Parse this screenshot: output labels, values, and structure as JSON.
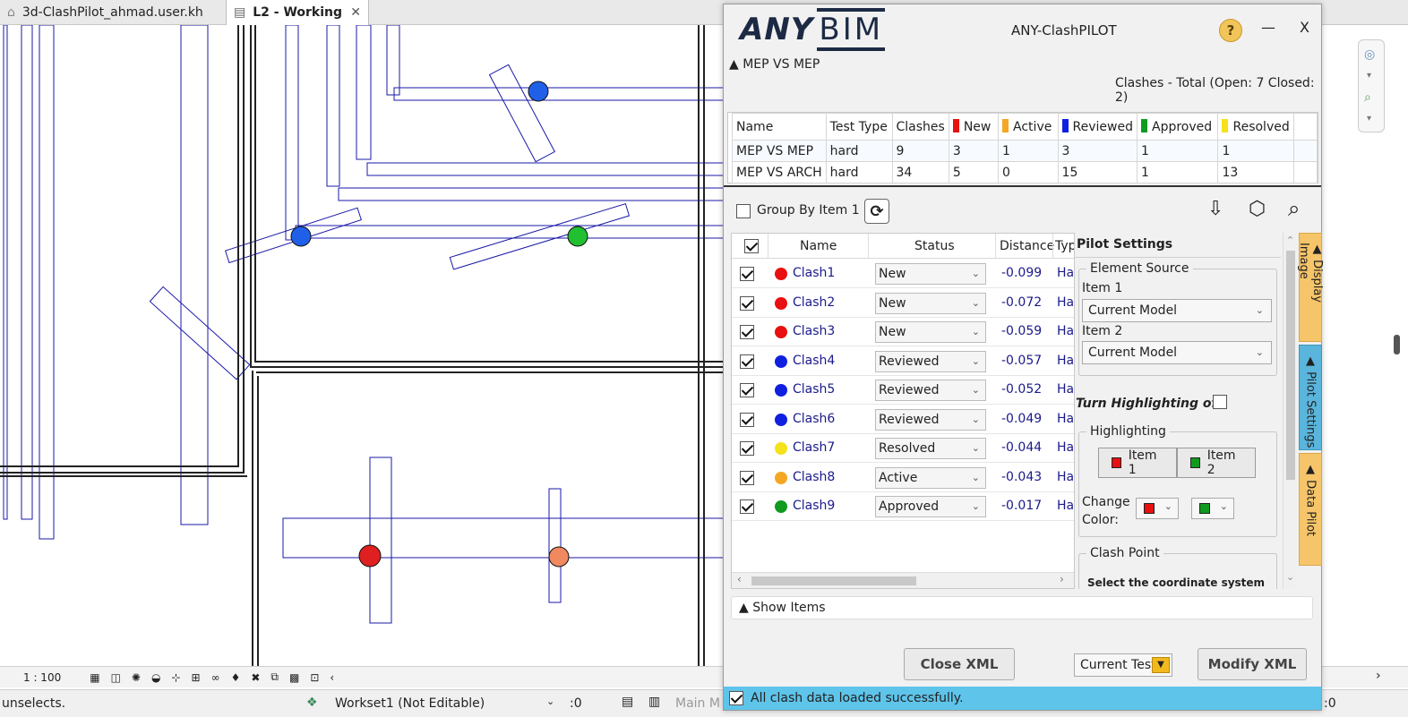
{
  "host": {
    "tabs": [
      {
        "label": "3d-ClashPilot_ahmad.user.kh",
        "active": false
      },
      {
        "label": "L2 - Working",
        "active": true
      }
    ],
    "scale": "1 : 100",
    "status_left": "unselects.",
    "workset": "Workset1 (Not Editable)",
    "workset_count": ":0",
    "main_model": "Main M",
    "right_count": ":0"
  },
  "plugin": {
    "logo_any": "ANY",
    "logo_bim": "BIM",
    "title": "ANY-ClashPILOT",
    "help": "?",
    "minimize": "—",
    "close": "X",
    "section": "▲ MEP VS MEP",
    "clash_summary": "Clashes - Total (Open: 7 Closed: 2)",
    "tests_table": {
      "headers": [
        "Name",
        "Test Type",
        "Clashes",
        "New",
        "Active",
        "Reviewed",
        "Approved",
        "Resolved"
      ],
      "header_colors": [
        "",
        "",
        "",
        "#e81010",
        "#f5a623",
        "#1020e0",
        "#109a20",
        "#f5e21a"
      ],
      "rows": [
        [
          "MEP VS MEP",
          "hard",
          "9",
          "3",
          "1",
          "3",
          "1",
          "1"
        ],
        [
          "MEP VS ARCH",
          "hard",
          "34",
          "5",
          "0",
          "15",
          "1",
          "13"
        ]
      ]
    },
    "group_by_label": "Group By Item 1",
    "clash_grid": {
      "headers": {
        "name": "Name",
        "status": "Status",
        "distance": "Distance",
        "type": "Typ"
      },
      "rows": [
        {
          "name": "Clash1",
          "status": "New",
          "distance": "-0.099",
          "type": "Ha",
          "color": "#e81010"
        },
        {
          "name": "Clash2",
          "status": "New",
          "distance": "-0.072",
          "type": "Ha",
          "color": "#e81010"
        },
        {
          "name": "Clash3",
          "status": "New",
          "distance": "-0.059",
          "type": "Ha",
          "color": "#e81010"
        },
        {
          "name": "Clash4",
          "status": "Reviewed",
          "distance": "-0.057",
          "type": "Ha",
          "color": "#1020e0"
        },
        {
          "name": "Clash5",
          "status": "Reviewed",
          "distance": "-0.052",
          "type": "Ha",
          "color": "#1020e0"
        },
        {
          "name": "Clash6",
          "status": "Reviewed",
          "distance": "-0.049",
          "type": "Ha",
          "color": "#1020e0"
        },
        {
          "name": "Clash7",
          "status": "Resolved",
          "distance": "-0.044",
          "type": "Ha",
          "color": "#f5e21a"
        },
        {
          "name": "Clash8",
          "status": "Active",
          "distance": "-0.043",
          "type": "Ha",
          "color": "#f5a623"
        },
        {
          "name": "Clash9",
          "status": "Approved",
          "distance": "-0.017",
          "type": "Ha",
          "color": "#109a20"
        }
      ]
    },
    "settings": {
      "title": "Pilot Settings",
      "element_source": "Element Source",
      "item1_label": "Item 1",
      "item1_value": "Current Model",
      "item2_label": "Item 2",
      "item2_value": "Current Model",
      "turn_highlighting": "Turn Highlighting off",
      "highlighting": "Highlighting",
      "hl_item1": "Item 1",
      "hl_item2": "Item 2",
      "hl_item1_color": "#e81010",
      "hl_item2_color": "#109a20",
      "change_color": "Change Color:",
      "clash_point": "Clash Point",
      "coord_text": "Select the coordinate system"
    },
    "side_tabs": [
      "▲ Display Image",
      "▲ Pilot Settings",
      "▲ Data Pilot"
    ],
    "show_items": "▲ Show Items",
    "close_xml": "Close XML",
    "current_test": "Current Test",
    "modify_xml": "Modify XML",
    "status_message": "All clash data loaded successfully."
  }
}
